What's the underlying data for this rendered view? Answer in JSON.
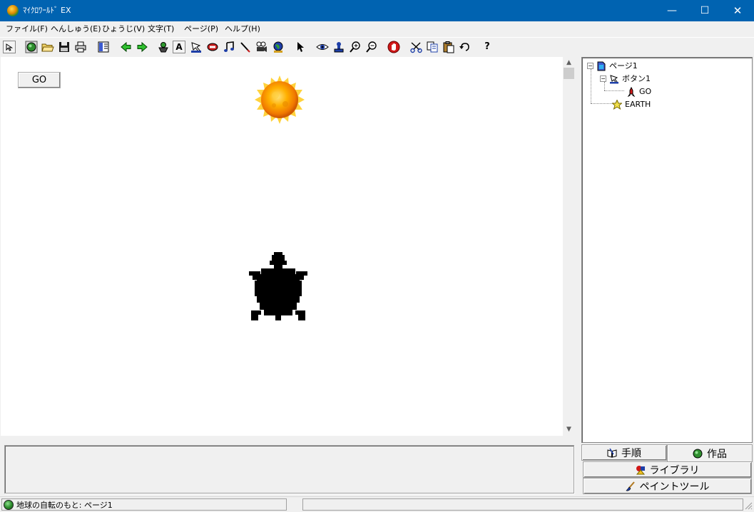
{
  "window": {
    "title": "ﾏｲｸﾛﾜｰﾙﾄﾞ EX",
    "minimize_glyph": "—",
    "maximize_glyph": "☐",
    "close_glyph": "✕"
  },
  "menu": [
    "ファイル(F)",
    "へんしゅう(E)",
    "ひょうじ(V)",
    "文字(T)",
    "ページ(P)",
    "ヘルプ(H)"
  ],
  "toolbar": {
    "icons": [
      "select-arrow-icon",
      "globe-icon",
      "open-folder-icon",
      "save-disk-icon",
      "print-icon",
      "panel-layout-icon",
      "back-arrow-icon",
      "forward-arrow-icon",
      "character-icon",
      "text-tool-icon",
      "button-tool-icon",
      "label-tool-icon",
      "music-note-icon",
      "pen-tool-icon",
      "movie-camera-icon",
      "earth-object-icon",
      "pointer-icon",
      "eye-icon",
      "stamp-icon",
      "zoom-in-icon",
      "zoom-out-icon",
      "stop-hand-icon",
      "scissors-icon",
      "copy-icon",
      "paste-icon",
      "undo-icon",
      "help-icon"
    ],
    "text_tool_glyph": "A",
    "help_glyph": "?"
  },
  "canvas": {
    "go_button_label": "GO",
    "objects": [
      "sun-image",
      "turtle-sprite"
    ]
  },
  "tree": {
    "page": "ページ1",
    "button_node": "ボタン1",
    "go_node": "GO",
    "earth_node": "EARTH",
    "expander_glyph": "−"
  },
  "tabs": {
    "procedure": "手順",
    "works": "作品",
    "library": "ライブラリ",
    "paint_tools": "ペイントツール"
  },
  "status": {
    "text": "地球の自転のもと: ページ1"
  },
  "colors": {
    "titlebar": "#0063b1",
    "sun": "#ffb000",
    "turtle": "#000000"
  }
}
